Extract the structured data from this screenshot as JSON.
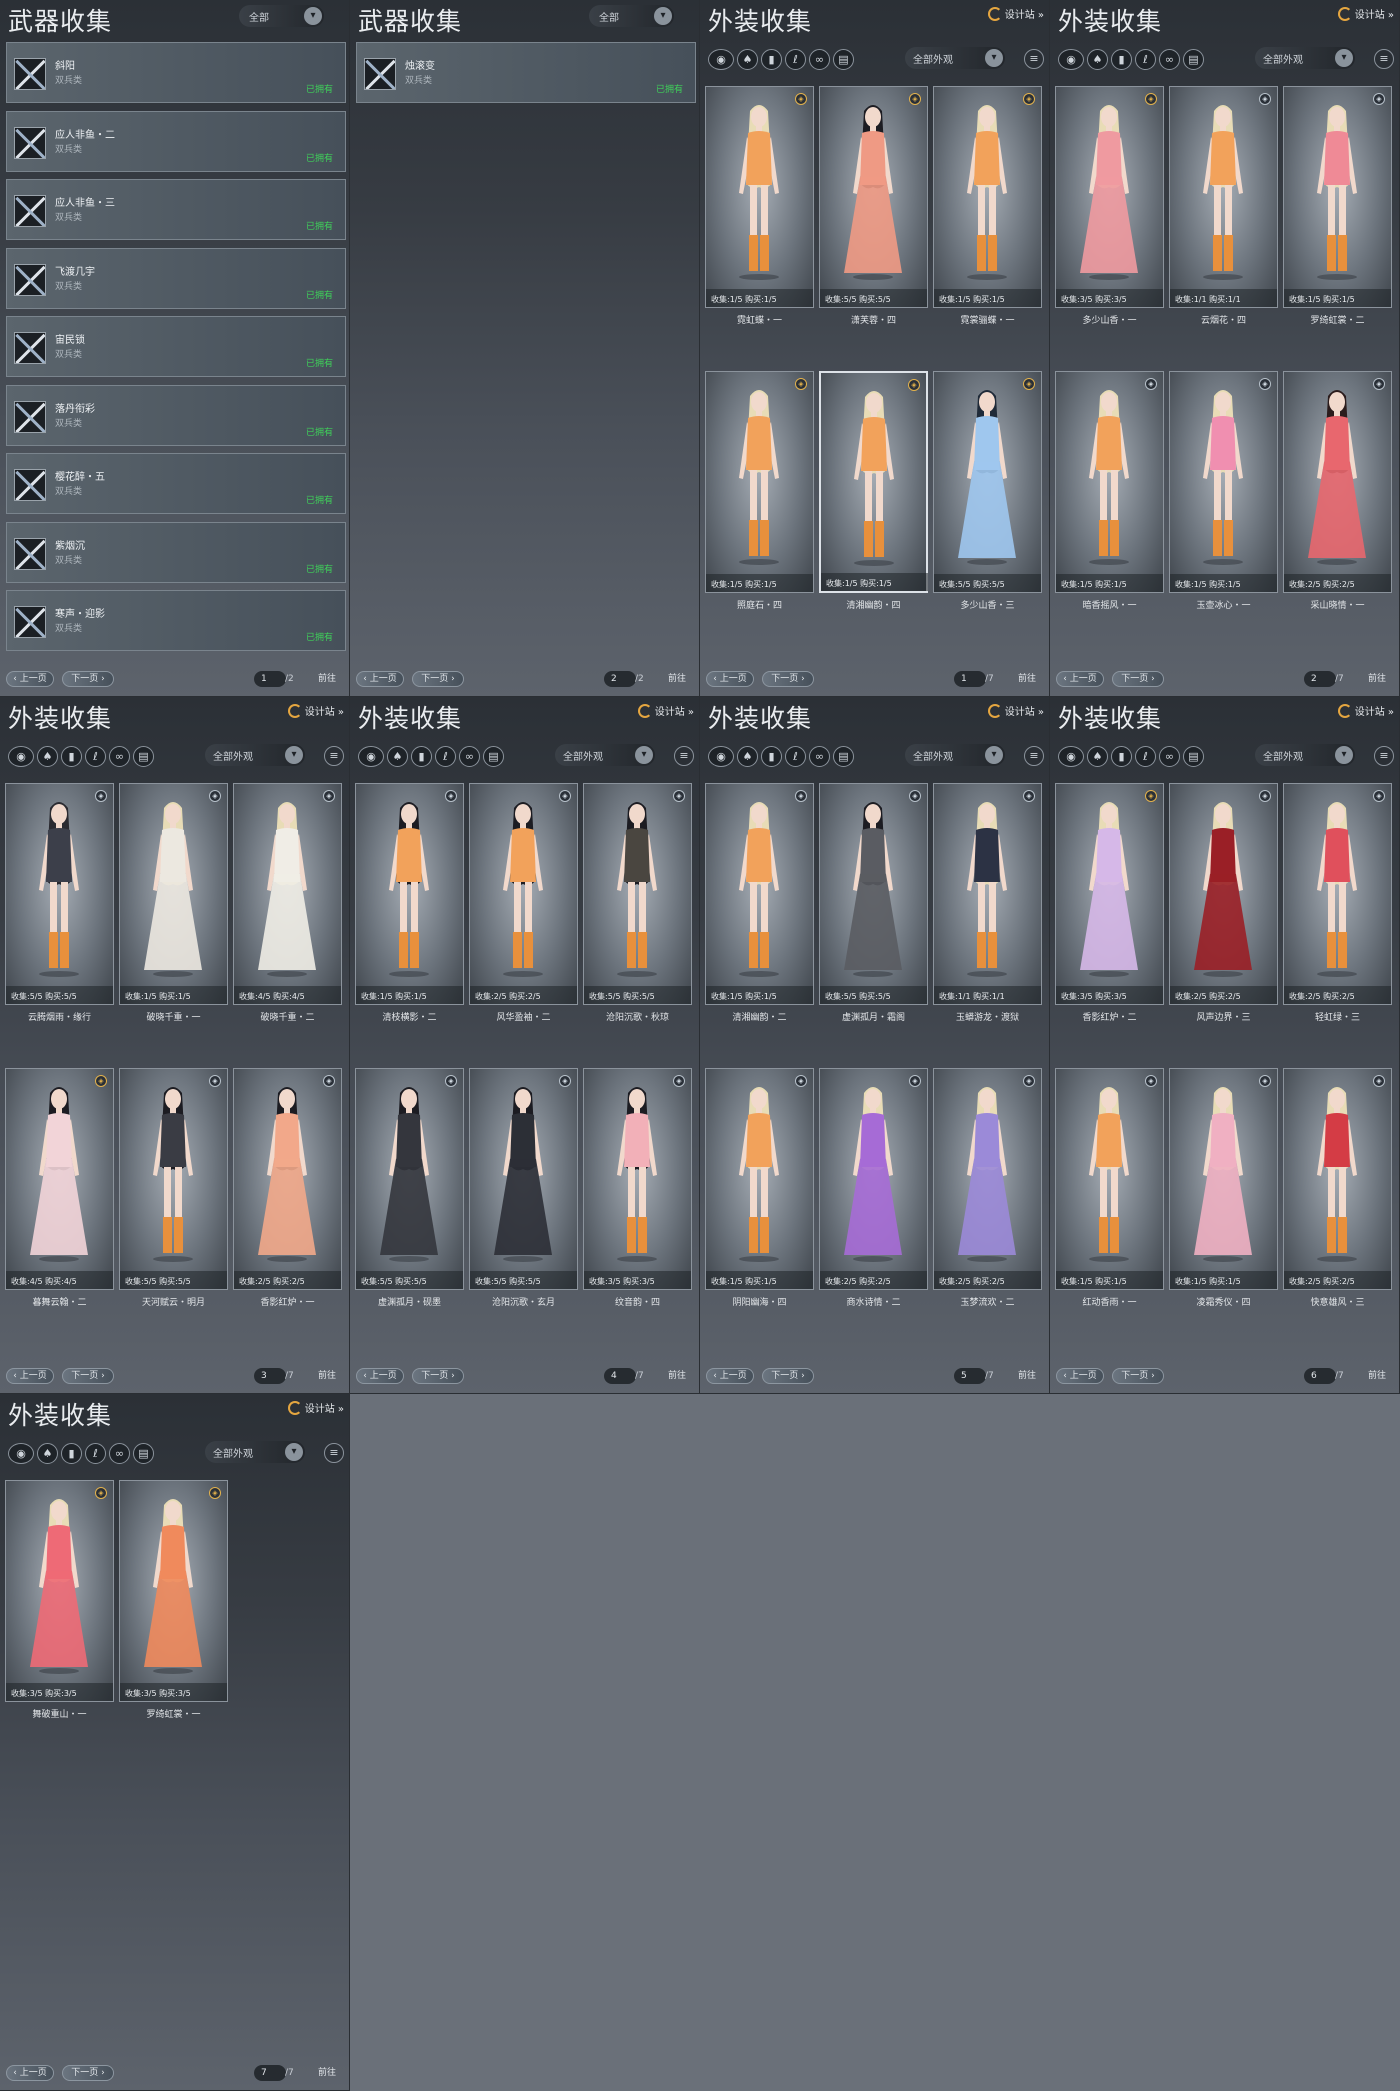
{
  "common": {
    "prev_label": "上一页",
    "next_label": "下一页",
    "jump_label": "前往",
    "designer_label": "设计站",
    "stats_collect_label": "收集:",
    "stats_buy_label": "购买:",
    "weapon_type": "双兵类",
    "weapon_status": "已拥有",
    "colors": {
      "owned": "#3fd15a",
      "designer_icon": "#e5a640"
    }
  },
  "weapon_filter_icons": [
    "chevron-down-icon"
  ],
  "appearance_category_icons": [
    "all-category-icon",
    "top-icon",
    "pants-icon",
    "hair-icon",
    "accessory-icon",
    "shoes-icon"
  ],
  "panels": [
    {
      "kind": "weapon",
      "title": "武器收集",
      "filter": "全部",
      "page": "1",
      "total": "/2",
      "items": [
        {
          "name": "斜阳"
        },
        {
          "name": "应人非鱼・二"
        },
        {
          "name": "应人非鱼・三"
        },
        {
          "name": "飞渡几宇"
        },
        {
          "name": "宙民锁"
        },
        {
          "name": "落丹衔彩"
        },
        {
          "name": "樱花醉・五"
        },
        {
          "name": "紫烟沉"
        },
        {
          "name": "寒声・迎影"
        }
      ]
    },
    {
      "kind": "weapon",
      "title": "武器收集",
      "filter": "全部",
      "page": "2",
      "total": "/2",
      "items": [
        {
          "name": "烛滚变"
        }
      ]
    },
    {
      "kind": "appearance",
      "title": "外装收集",
      "filter": "全部外观",
      "page": "1",
      "total": "/7",
      "cards": [
        {
          "name": "霓虹蝶・一",
          "collect": "1/5",
          "buy": "1/5",
          "badge": "gold",
          "outfit": "#f2a25b",
          "hair": "#e8dcb6",
          "skirt": false,
          "selected": false
        },
        {
          "name": "潇芙蓉・四",
          "collect": "5/5",
          "buy": "5/5",
          "badge": "gold",
          "outfit": "#ef9a84",
          "hair": "#1c1c22",
          "skirt": true,
          "selected": false
        },
        {
          "name": "霓裳骊蝶・一",
          "collect": "1/5",
          "buy": "1/5",
          "badge": "gold",
          "outfit": "#f2a25b",
          "hair": "#e8dcb6",
          "skirt": false,
          "selected": false
        },
        {
          "name": "照庭石・四",
          "collect": "1/5",
          "buy": "1/5",
          "badge": "gold",
          "outfit": "#f2a25b",
          "hair": "#e8dcb6",
          "skirt": false,
          "selected": false
        },
        {
          "name": "清湘幽韵・四",
          "collect": "1/5",
          "buy": "1/5",
          "badge": "gold",
          "outfit": "#f2a25b",
          "hair": "#e8dcb6",
          "skirt": false,
          "selected": true
        },
        {
          "name": "多少山香・三",
          "collect": "5/5",
          "buy": "5/5",
          "badge": "gold",
          "outfit": "#9fc7ee",
          "hair": "#1f2a38",
          "skirt": true,
          "selected": false
        }
      ]
    },
    {
      "kind": "appearance",
      "title": "外装收集",
      "filter": "全部外观",
      "page": "2",
      "total": "/7",
      "cards": [
        {
          "name": "多少山香・一",
          "collect": "3/5",
          "buy": "3/5",
          "badge": "gold",
          "outfit": "#ef9aa0",
          "hair": "#e8dcb6",
          "skirt": true,
          "selected": false
        },
        {
          "name": "云烟花・四",
          "collect": "1/1",
          "buy": "1/1",
          "badge": "blue",
          "outfit": "#f2a25b",
          "hair": "#e8dcb6",
          "skirt": false,
          "selected": false
        },
        {
          "name": "罗绮虹裳・二",
          "collect": "1/5",
          "buy": "1/5",
          "badge": "blue",
          "outfit": "#ef8a96",
          "hair": "#e8dcb6",
          "skirt": false,
          "selected": false
        },
        {
          "name": "暗香摇风・一",
          "collect": "1/5",
          "buy": "1/5",
          "badge": "blue",
          "outfit": "#f2a25b",
          "hair": "#e8dcb6",
          "skirt": false,
          "selected": false
        },
        {
          "name": "玉壶冰心・一",
          "collect": "1/5",
          "buy": "1/5",
          "badge": "blue",
          "outfit": "#f08fb0",
          "hair": "#e8dcb6",
          "skirt": false,
          "selected": false
        },
        {
          "name": "采山晓情・一",
          "collect": "2/5",
          "buy": "2/5",
          "badge": "blue",
          "outfit": "#e8676e",
          "hair": "#2b1c1c",
          "skirt": true,
          "selected": false
        }
      ]
    },
    {
      "kind": "appearance",
      "title": "外装收集",
      "filter": "全部外观",
      "page": "3",
      "total": "/7",
      "cards": [
        {
          "name": "云腾烟雨・缘行",
          "collect": "5/5",
          "buy": "5/5",
          "badge": "blue",
          "outfit": "#3c3f4a",
          "hair": "#2a2a30",
          "skirt": false,
          "selected": false
        },
        {
          "name": "破晓千重・一",
          "collect": "1/5",
          "buy": "1/5",
          "badge": "blue",
          "outfit": "#ece8e0",
          "hair": "#e8dcb6",
          "skirt": true,
          "selected": false
        },
        {
          "name": "破晓千重・二",
          "collect": "4/5",
          "buy": "4/5",
          "badge": "blue",
          "outfit": "#f0ede6",
          "hair": "#e8dcb6",
          "skirt": true,
          "selected": false
        },
        {
          "name": "暮舞云翰・二",
          "collect": "4/5",
          "buy": "4/5",
          "badge": "gold",
          "outfit": "#f2d4d8",
          "hair": "#1c1c22",
          "skirt": true,
          "selected": false
        },
        {
          "name": "天河赋云・明月",
          "collect": "5/5",
          "buy": "5/5",
          "badge": "blue",
          "outfit": "#3a3c44",
          "hair": "#1c1c22",
          "skirt": false,
          "selected": false
        },
        {
          "name": "香影红炉・一",
          "collect": "2/5",
          "buy": "2/5",
          "badge": "blue",
          "outfit": "#f2a88a",
          "hair": "#1c1c22",
          "skirt": true,
          "selected": false
        }
      ]
    },
    {
      "kind": "appearance",
      "title": "外装收集",
      "filter": "全部外观",
      "page": "4",
      "total": "/7",
      "cards": [
        {
          "name": "清枝横影・二",
          "collect": "1/5",
          "buy": "1/5",
          "badge": "blue",
          "outfit": "#f2a25b",
          "hair": "#1c1c22",
          "skirt": false,
          "selected": false
        },
        {
          "name": "风华盈袖・二",
          "collect": "2/5",
          "buy": "2/5",
          "badge": "blue",
          "outfit": "#f2a25b",
          "hair": "#1c1c22",
          "skirt": false,
          "selected": false
        },
        {
          "name": "沧阳沉歌・秋琼",
          "collect": "5/5",
          "buy": "5/5",
          "badge": "blue",
          "outfit": "#4a4640",
          "hair": "#1c1c22",
          "skirt": false,
          "selected": false
        },
        {
          "name": "虚渊孤月・砚墨",
          "collect": "5/5",
          "buy": "5/5",
          "badge": "blue",
          "outfit": "#34363d",
          "hair": "#1c1c22",
          "skirt": true,
          "selected": false
        },
        {
          "name": "沧阳沉歌・玄月",
          "collect": "5/5",
          "buy": "5/5",
          "badge": "blue",
          "outfit": "#2c2f36",
          "hair": "#1c1c22",
          "skirt": true,
          "selected": false
        },
        {
          "name": "纹音韵・四",
          "collect": "3/5",
          "buy": "3/5",
          "badge": "blue",
          "outfit": "#f2b0b8",
          "hair": "#1c1c22",
          "skirt": false,
          "selected": false
        }
      ]
    },
    {
      "kind": "appearance",
      "title": "外装收集",
      "filter": "全部外观",
      "page": "5",
      "total": "/7",
      "cards": [
        {
          "name": "清湘幽韵・二",
          "collect": "1/5",
          "buy": "1/5",
          "badge": "blue",
          "outfit": "#f2a25b",
          "hair": "#e8dcb6",
          "skirt": false,
          "selected": false
        },
        {
          "name": "虚渊孤月・霜阁",
          "collect": "5/5",
          "buy": "5/5",
          "badge": "blue",
          "outfit": "#5a5c62",
          "hair": "#1c1c22",
          "skirt": true,
          "selected": false
        },
        {
          "name": "玉蟒游龙・渡狱",
          "collect": "1/1",
          "buy": "1/1",
          "badge": "blue",
          "outfit": "#2c3244",
          "hair": "#e8dcb6",
          "skirt": false,
          "selected": false
        },
        {
          "name": "阴阳幽海・四",
          "collect": "1/5",
          "buy": "1/5",
          "badge": "blue",
          "outfit": "#f2a25b",
          "hair": "#e8dcb6",
          "skirt": false,
          "selected": false
        },
        {
          "name": "商水诗情・二",
          "collect": "2/5",
          "buy": "2/5",
          "badge": "blue",
          "outfit": "#a66bd6",
          "hair": "#e8dcb6",
          "skirt": true,
          "selected": false
        },
        {
          "name": "玉梦流欢・二",
          "collect": "2/5",
          "buy": "2/5",
          "badge": "blue",
          "outfit": "#9b8ad8",
          "hair": "#e8dcb6",
          "skirt": true,
          "selected": false
        }
      ]
    },
    {
      "kind": "appearance",
      "title": "外装收集",
      "filter": "全部外观",
      "page": "6",
      "total": "/7",
      "cards": [
        {
          "name": "香影红炉・二",
          "collect": "3/5",
          "buy": "3/5",
          "badge": "gold",
          "outfit": "#d6b8e8",
          "hair": "#e8dcb6",
          "skirt": true,
          "selected": false
        },
        {
          "name": "风声边界・三",
          "collect": "2/5",
          "buy": "2/5",
          "badge": "blue",
          "outfit": "#9a1f26",
          "hair": "#e8dcb6",
          "skirt": true,
          "selected": false
        },
        {
          "name": "轻虹绿・三",
          "collect": "2/5",
          "buy": "2/5",
          "badge": "blue",
          "outfit": "#e0505c",
          "hair": "#e8dcb6",
          "skirt": false,
          "selected": false
        },
        {
          "name": "红动香雨・一",
          "collect": "1/5",
          "buy": "1/5",
          "badge": "blue",
          "outfit": "#f2a25b",
          "hair": "#e8dcb6",
          "skirt": false,
          "selected": false
        },
        {
          "name": "凌霜秀仪・四",
          "collect": "1/5",
          "buy": "1/5",
          "badge": "blue",
          "outfit": "#f0b0c2",
          "hair": "#e8dcb6",
          "skirt": true,
          "selected": false
        },
        {
          "name": "快意雄风・三",
          "collect": "2/5",
          "buy": "2/5",
          "badge": "blue",
          "outfit": "#d43c45",
          "hair": "#e8dcb6",
          "skirt": false,
          "selected": false
        }
      ]
    },
    {
      "kind": "appearance",
      "title": "外装收集",
      "filter": "全部外观",
      "page": "7",
      "total": "/7",
      "cards": [
        {
          "name": "舞破重山・一",
          "collect": "3/5",
          "buy": "3/5",
          "badge": "gold",
          "outfit": "#ee6a76",
          "hair": "#e8dcb6",
          "skirt": true,
          "selected": false
        },
        {
          "name": "罗绮虹裳・一",
          "collect": "3/5",
          "buy": "3/5",
          "badge": "gold",
          "outfit": "#f08a5c",
          "hair": "#e8dcb6",
          "skirt": true,
          "selected": false
        }
      ]
    }
  ]
}
